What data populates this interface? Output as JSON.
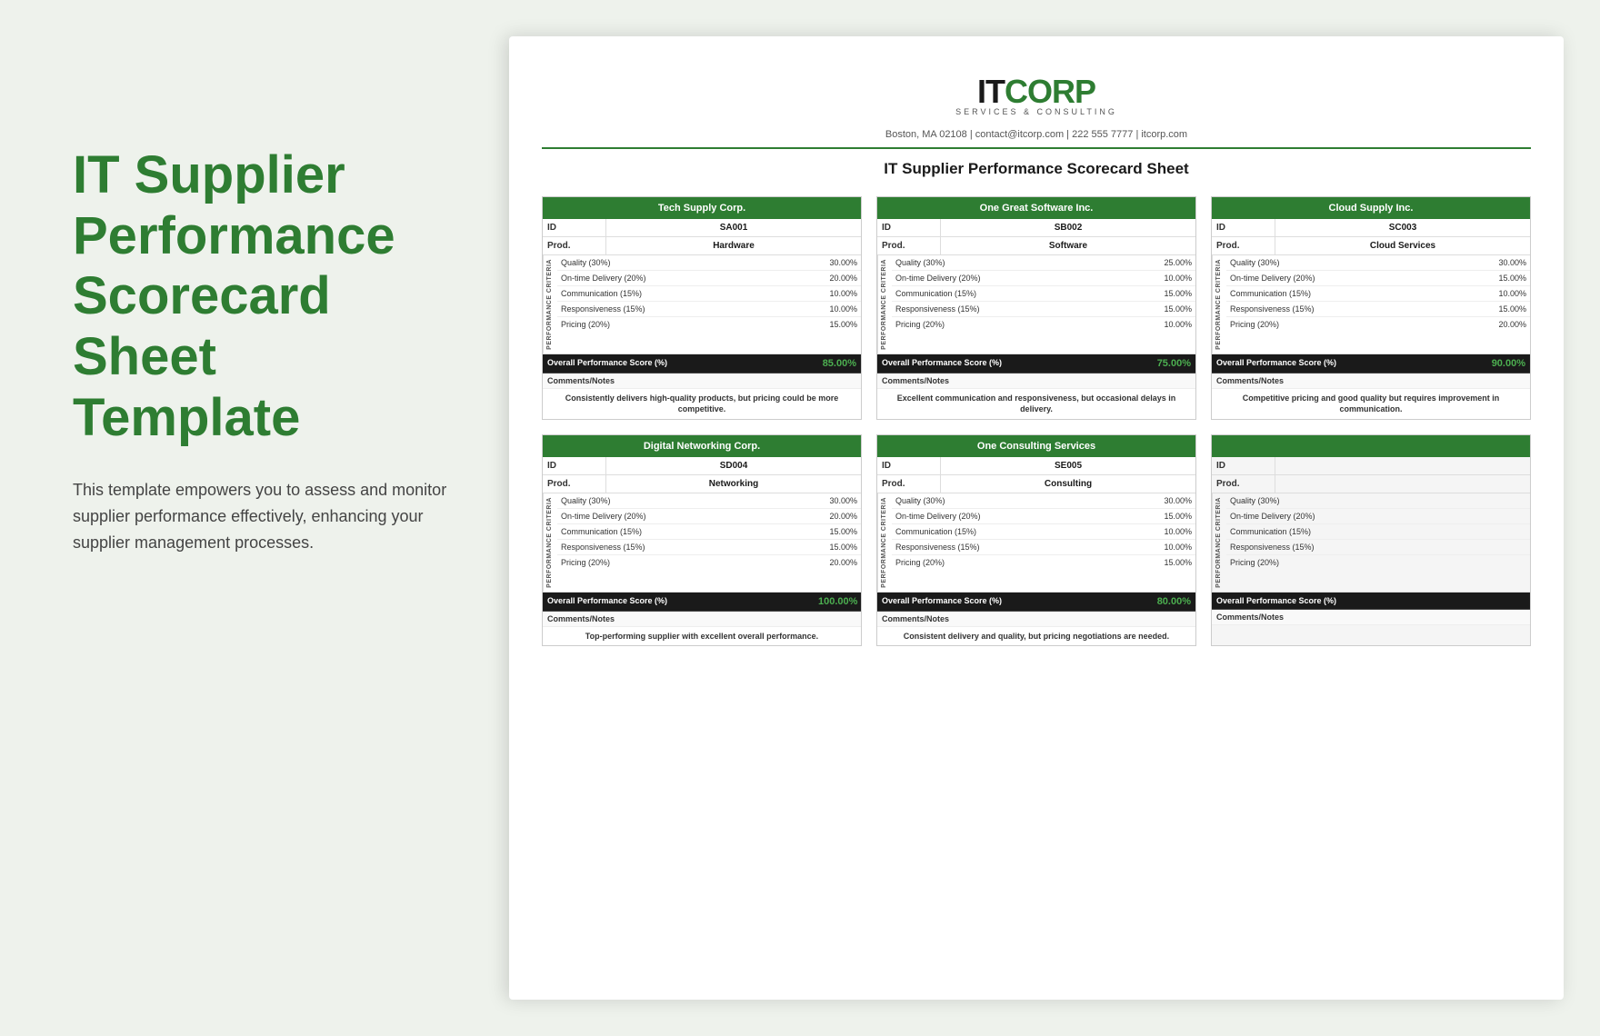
{
  "left": {
    "title": "IT Supplier Performance Scorecard Sheet Template",
    "description": "This template empowers you to assess and monitor supplier performance effectively, enhancing your supplier management processes."
  },
  "doc": {
    "logo": {
      "it": "IT",
      "corp": "CORP",
      "subtitle": "SERVICES & CONSULTING",
      "address": "Boston, MA 02108  |  contact@itcorp.com  |  222 555 7777  |  itcorp.com"
    },
    "title": "IT Supplier Performance Scorecard Sheet",
    "scorecards": [
      {
        "name": "Tech Supply Corp.",
        "id": "SA001",
        "product": "Hardware",
        "criteria": [
          {
            "name": "Quality (30%)",
            "value": "30.00%"
          },
          {
            "name": "On-time Delivery (20%)",
            "value": "20.00%"
          },
          {
            "name": "Communication (15%)",
            "value": "10.00%"
          },
          {
            "name": "Responsiveness (15%)",
            "value": "10.00%"
          },
          {
            "name": "Pricing (20%)",
            "value": "15.00%"
          }
        ],
        "overall": "85.00%",
        "comments": "Consistently delivers high-quality products, but pricing could be more competitive."
      },
      {
        "name": "One Great Software Inc.",
        "id": "SB002",
        "product": "Software",
        "criteria": [
          {
            "name": "Quality (30%)",
            "value": "25.00%"
          },
          {
            "name": "On-time Delivery (20%)",
            "value": "10.00%"
          },
          {
            "name": "Communication (15%)",
            "value": "15.00%"
          },
          {
            "name": "Responsiveness (15%)",
            "value": "15.00%"
          },
          {
            "name": "Pricing (20%)",
            "value": "10.00%"
          }
        ],
        "overall": "75.00%",
        "comments": "Excellent communication and responsiveness, but occasional delays in delivery."
      },
      {
        "name": "Cloud Supply Inc.",
        "id": "SC003",
        "product": "Cloud Services",
        "criteria": [
          {
            "name": "Quality (30%)",
            "value": "30.00%"
          },
          {
            "name": "On-time Delivery (20%)",
            "value": "15.00%"
          },
          {
            "name": "Communication (15%)",
            "value": "10.00%"
          },
          {
            "name": "Responsiveness (15%)",
            "value": "15.00%"
          },
          {
            "name": "Pricing (20%)",
            "value": "20.00%"
          }
        ],
        "overall": "90.00%",
        "comments": "Competitive pricing and good quality but requires improvement in communication."
      },
      {
        "name": "Digital Networking Corp.",
        "id": "SD004",
        "product": "Networking",
        "criteria": [
          {
            "name": "Quality (30%)",
            "value": "30.00%"
          },
          {
            "name": "On-time Delivery (20%)",
            "value": "20.00%"
          },
          {
            "name": "Communication (15%)",
            "value": "15.00%"
          },
          {
            "name": "Responsiveness (15%)",
            "value": "15.00%"
          },
          {
            "name": "Pricing (20%)",
            "value": "20.00%"
          }
        ],
        "overall": "100.00%",
        "comments": "Top-performing supplier with excellent overall performance."
      },
      {
        "name": "One Consulting Services",
        "id": "SE005",
        "product": "Consulting",
        "criteria": [
          {
            "name": "Quality (30%)",
            "value": "30.00%"
          },
          {
            "name": "On-time Delivery (20%)",
            "value": "15.00%"
          },
          {
            "name": "Communication (15%)",
            "value": "10.00%"
          },
          {
            "name": "Responsiveness (15%)",
            "value": "10.00%"
          },
          {
            "name": "Pricing (20%)",
            "value": "15.00%"
          }
        ],
        "overall": "80.00%",
        "comments": "Consistent delivery and quality, but pricing negotiations are needed."
      },
      {
        "name": "",
        "id": "",
        "product": "",
        "criteria": [
          {
            "name": "Quality (30%)",
            "value": ""
          },
          {
            "name": "On-time Delivery (20%)",
            "value": ""
          },
          {
            "name": "Communication (15%)",
            "value": ""
          },
          {
            "name": "Responsiveness (15%)",
            "value": ""
          },
          {
            "name": "Pricing (20%)",
            "value": ""
          }
        ],
        "overall": "",
        "comments": ""
      }
    ],
    "labels": {
      "id": "ID",
      "product": "Prod.",
      "performance_criteria": "PERFORMANCE CRITERIA",
      "overall": "Overall Performance Score (%)",
      "comments": "Comments/Notes"
    }
  }
}
